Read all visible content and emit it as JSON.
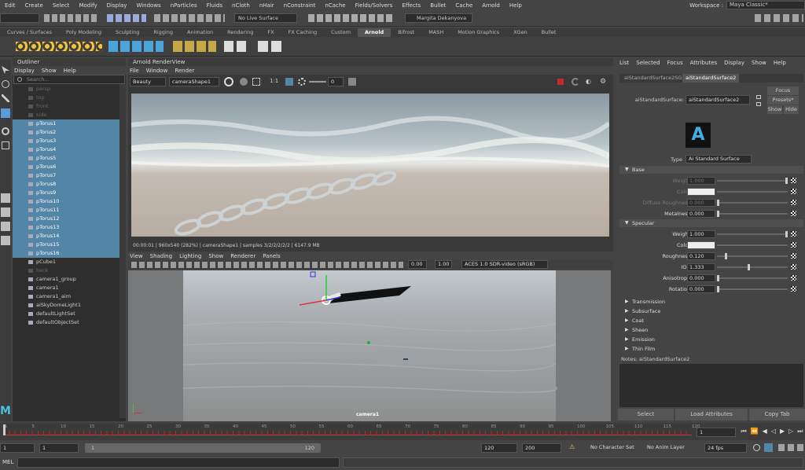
{
  "menubar": {
    "items": [
      "Edit",
      "Create",
      "Select",
      "Modify",
      "Display",
      "Windows",
      "nParticles",
      "Fluids",
      "nCloth",
      "nHair",
      "nConstraint",
      "nCache",
      "Fields/Solvers",
      "Effects",
      "Bullet",
      "Cache",
      "Arnold",
      "Help"
    ],
    "workspace_label": "Workspace :",
    "workspace_value": "Maya Classic*"
  },
  "status": {
    "live_surface": "No Live Surface",
    "user": "Margita Dekanyova"
  },
  "shelf_tabs": [
    "Curves / Surfaces",
    "Poly Modeling",
    "Sculpting",
    "Rigging",
    "Animation",
    "Rendering",
    "FX",
    "FX Caching",
    "Custom",
    "Arnold",
    "Bifrost",
    "MASH",
    "Motion Graphics",
    "XGen",
    "Bullet"
  ],
  "shelf_active": "Arnold",
  "outliner": {
    "title": "Outliner",
    "menu": [
      "Display",
      "Show",
      "Help"
    ],
    "search_placeholder": "Search...",
    "items": [
      {
        "label": "persp",
        "state": "dim"
      },
      {
        "label": "top",
        "state": "dim"
      },
      {
        "label": "front",
        "state": "dim"
      },
      {
        "label": "side",
        "state": "dim"
      },
      {
        "label": "pTorus1",
        "state": "sel"
      },
      {
        "label": "pTorus2",
        "state": "sel"
      },
      {
        "label": "pTorus3",
        "state": "sel"
      },
      {
        "label": "pTorus4",
        "state": "sel"
      },
      {
        "label": "pTorus5",
        "state": "sel"
      },
      {
        "label": "pTorus6",
        "state": "sel"
      },
      {
        "label": "pTorus7",
        "state": "sel"
      },
      {
        "label": "pTorus8",
        "state": "sel"
      },
      {
        "label": "pTorus9",
        "state": "sel"
      },
      {
        "label": "pTorus10",
        "state": "sel"
      },
      {
        "label": "pTorus11",
        "state": "sel"
      },
      {
        "label": "pTorus12",
        "state": "sel"
      },
      {
        "label": "pTorus13",
        "state": "sel"
      },
      {
        "label": "pTorus14",
        "state": "sel"
      },
      {
        "label": "pTorus15",
        "state": "sel"
      },
      {
        "label": "pTorus16",
        "state": "sel"
      },
      {
        "label": "pCube1",
        "state": "norm"
      },
      {
        "label": "back",
        "state": "dim"
      },
      {
        "label": "camera1_group",
        "state": "norm"
      },
      {
        "label": "camera1",
        "state": "norm"
      },
      {
        "label": "camera1_aim",
        "state": "norm"
      },
      {
        "label": "aiSkyDomeLight1",
        "state": "norm"
      },
      {
        "label": "defaultLightSet",
        "state": "norm"
      },
      {
        "label": "defaultObjectSet",
        "state": "norm"
      }
    ]
  },
  "renderview": {
    "title": "Arnold RenderView",
    "menu": [
      "File",
      "Window",
      "Render"
    ],
    "aov": "Beauty",
    "camera": "cameraShape1",
    "ratio": "1:1",
    "exposure": "0",
    "status_line": "00:00:01 | 960x540 (282%) | cameraShape1 | samples 3/2/2/2/2/2 | 6147.9 MB"
  },
  "viewport": {
    "menu": [
      "View",
      "Shading",
      "Lighting",
      "Show",
      "Renderer",
      "Panels"
    ],
    "val1": "0.00",
    "val2": "1.00",
    "colorspace": "ACES 1.0 SDR-video (sRGB)",
    "camera_label": "camera1"
  },
  "attr": {
    "menu": [
      "List",
      "Selected",
      "Focus",
      "Attributes",
      "Display",
      "Show",
      "Help"
    ],
    "tabs": [
      "aiStandardSurface2SG",
      "aiStandardSurface2"
    ],
    "node_label": "aiStandardSurface:",
    "node_value": "aiStandardSurface2",
    "focus": "Focus",
    "presets": "Presets*",
    "show": "Show",
    "hide": "Hide",
    "type_label": "Type",
    "type_value": "Ai Standard Surface",
    "base_title": "Base",
    "base": [
      {
        "label": "Weight",
        "value": "1.000",
        "dim": true
      },
      {
        "label": "Color",
        "value": "",
        "dim": true
      },
      {
        "label": "Diffuse Roughness",
        "value": "0.000",
        "dim": true
      },
      {
        "label": "Metalness",
        "value": "0.000",
        "dim": false
      }
    ],
    "specular_title": "Specular",
    "specular": [
      {
        "label": "Weight",
        "value": "1.000"
      },
      {
        "label": "Color",
        "value": ""
      },
      {
        "label": "Roughness",
        "value": "0.120"
      },
      {
        "label": "IOR",
        "value": "1.333"
      },
      {
        "label": "Anisotropy",
        "value": "0.000"
      },
      {
        "label": "Rotation",
        "value": "0.000"
      }
    ],
    "closed_sections": [
      "Transmission",
      "Subsurface",
      "Coat",
      "Sheen",
      "Emission",
      "Thin Film"
    ],
    "notes": "Notes:  aiStandardSurface2",
    "buttons": [
      "Select",
      "Load Attributes",
      "Copy Tab"
    ]
  },
  "timeline": {
    "ticks": [
      "1",
      "5",
      "10",
      "15",
      "20",
      "25",
      "30",
      "35",
      "40",
      "45",
      "50",
      "55",
      "60",
      "65",
      "70",
      "75",
      "80",
      "85",
      "90",
      "95",
      "100",
      "105",
      "110",
      "115",
      "120"
    ],
    "current": "1"
  },
  "range": {
    "start": "1",
    "anim_start": "1",
    "slider_start": "1",
    "slider_end": "120",
    "end": "120",
    "anim_end": "200",
    "char_set": "No Character Set",
    "anim_layer": "No Anim Layer",
    "fps": "24 fps"
  },
  "cmd": {
    "label": "MEL"
  },
  "colors": {
    "selection": "#5285a6",
    "accent": "#4a8fc5",
    "timeline_red": "#b03030"
  }
}
